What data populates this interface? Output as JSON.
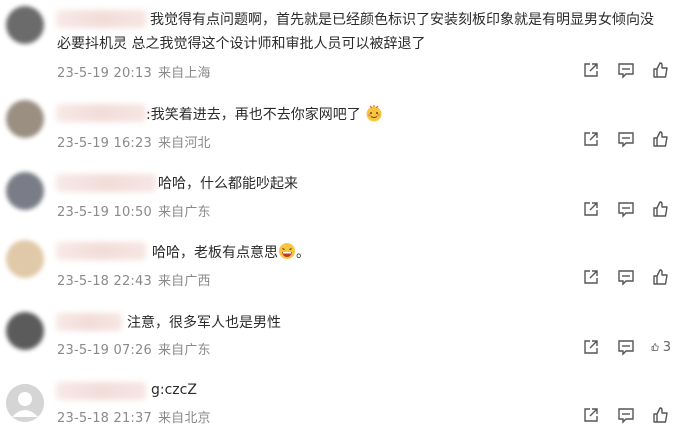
{
  "comments": [
    {
      "text_line1": "我觉得有点问题啊，首先就是已经颜色标识了安装刻板印象就是有明显男女倾向没",
      "text_line2": "必要抖机灵 总之我觉得这个设计师和审批人员可以被辞退了",
      "time": "23-5-19 20:13",
      "location": "来自上海",
      "avatar_color": "#6b6b6b"
    },
    {
      "text_line1": ":我笑着进去，再也不去你家网吧了",
      "time": "23-5-19 16:23",
      "location": "来自河北",
      "avatar_color": "#9a8f80"
    },
    {
      "text_line1": "哈哈，什么都能吵起来",
      "time": "23-5-19 10:50",
      "location": "来自广东",
      "avatar_color": "#7a7d87"
    },
    {
      "text_line1": "哈哈，老板有点意思",
      "text_suffix": "。",
      "time": "23-5-18 22:43",
      "location": "来自广西",
      "avatar_color": "#e0c9a8"
    },
    {
      "text_line1": "注意，很多军人也是男性",
      "time": "23-5-19 07:26",
      "location": "来自广东",
      "avatar_color": "#5b5b5b",
      "like_count": "3"
    },
    {
      "text_line1": "g:czcZ",
      "time": "23-5-18 21:37",
      "location": "来自北京",
      "avatar_color": "#c8c8c8"
    }
  ],
  "icons": {
    "share": "share-icon",
    "comment": "comment-icon",
    "like": "thumbs-up-icon"
  }
}
